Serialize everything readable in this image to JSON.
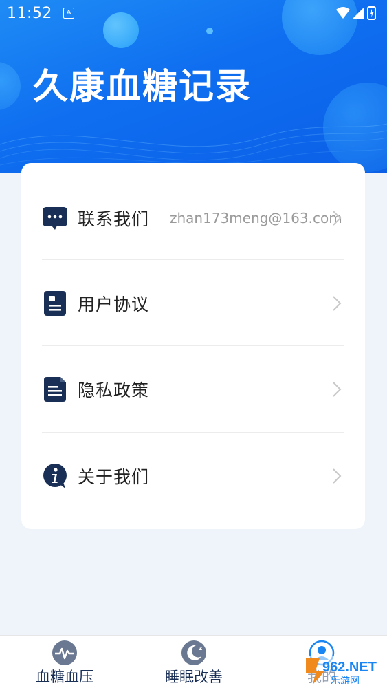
{
  "status_bar": {
    "time": "11:52",
    "notification_icon": "A"
  },
  "header": {
    "title": "久康血糖记录"
  },
  "menu": {
    "items": [
      {
        "label": "联系我们",
        "value": "zhan173meng@163.com",
        "icon": "chat-bubble-icon"
      },
      {
        "label": "用户协议",
        "value": "",
        "icon": "document-icon"
      },
      {
        "label": "隐私政策",
        "value": "",
        "icon": "file-list-icon"
      },
      {
        "label": "关于我们",
        "value": "",
        "icon": "info-icon"
      }
    ]
  },
  "tabbar": {
    "tabs": [
      {
        "label": "血糖血压",
        "icon": "heartbeat-icon",
        "active": false
      },
      {
        "label": "睡眠改善",
        "icon": "moon-sleep-icon",
        "active": false
      },
      {
        "label": "我的",
        "icon": "user-profile-icon",
        "active": true
      }
    ]
  },
  "watermark": {
    "text": "962.NET",
    "subtext": "乐游网"
  },
  "colors": {
    "primary": "#1a86f3",
    "icon_navy": "#1a2f56",
    "background": "#eef4fa"
  }
}
